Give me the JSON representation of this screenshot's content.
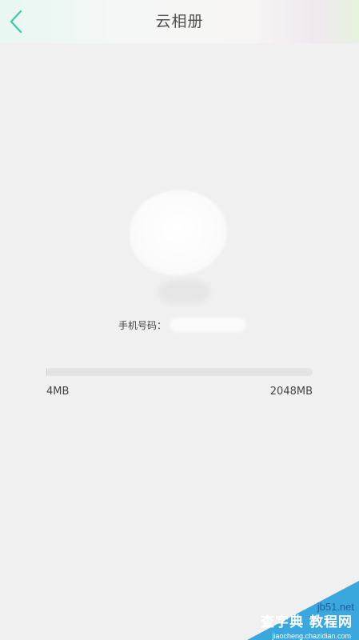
{
  "header": {
    "title": "云相册"
  },
  "icons": {
    "back": "chevron-left-icon"
  },
  "colors": {
    "accent": "#3ec8a8",
    "watermark": "#3aa7de"
  },
  "profile": {
    "phone_label": "手机号码："
  },
  "storage": {
    "used": "4MB",
    "total": "2048MB",
    "used_fraction": 0.002
  },
  "watermark": {
    "site": "jb51.net",
    "main": "查字典 教程网",
    "url": "jiaocheng.chazidian.com"
  }
}
